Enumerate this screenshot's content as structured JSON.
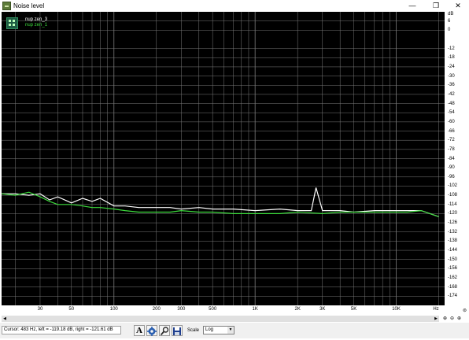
{
  "window": {
    "title": "Noise level",
    "minimize_glyph": "—",
    "maximize_glyph": "❒",
    "close_glyph": "✕"
  },
  "legend": {
    "items": [
      {
        "label": "nup zen_3",
        "color": "#ffffff"
      },
      {
        "label": "nup zen_1",
        "color": "#3ddc3d"
      }
    ]
  },
  "yaxis": {
    "unit": "dB",
    "ticks": [
      "6",
      "0",
      "-12",
      "-18",
      "-24",
      "-30",
      "-36",
      "-42",
      "-48",
      "-54",
      "-60",
      "-66",
      "-72",
      "-78",
      "-84",
      "-90",
      "-96",
      "-102",
      "-108",
      "-114",
      "-120",
      "-126",
      "-132",
      "-138",
      "-144",
      "-150",
      "-156",
      "-162",
      "-168",
      "-174"
    ],
    "tick_values": [
      6,
      0,
      -12,
      -18,
      -24,
      -30,
      -36,
      -42,
      -48,
      -54,
      -60,
      -66,
      -72,
      -78,
      -84,
      -90,
      -96,
      -102,
      -108,
      -114,
      -120,
      -126,
      -132,
      -138,
      -144,
      -150,
      -156,
      -162,
      -168,
      -174
    ]
  },
  "xaxis": {
    "unit": "Hz",
    "ticks": [
      {
        "label": "30",
        "value": 30
      },
      {
        "label": "50",
        "value": 50
      },
      {
        "label": "100",
        "value": 100
      },
      {
        "label": "200",
        "value": 200
      },
      {
        "label": "300",
        "value": 300
      },
      {
        "label": "500",
        "value": 500
      },
      {
        "label": "1K",
        "value": 1000
      },
      {
        "label": "2K",
        "value": 2000
      },
      {
        "label": "3K",
        "value": 3000
      },
      {
        "label": "5K",
        "value": 5000
      },
      {
        "label": "10K",
        "value": 10000
      }
    ]
  },
  "chart_data": {
    "type": "line",
    "title": "",
    "xlabel": "Hz",
    "ylabel": "dB",
    "x_scale": "log",
    "xlim": [
      16,
      22000
    ],
    "ylim": [
      -180,
      12
    ],
    "grid": true,
    "legend_placement": "top-left",
    "background": "#000000",
    "grid_color": "#7a7a7a",
    "series": [
      {
        "name": "nup zen_3",
        "color": "#ffffff",
        "x": [
          16,
          20,
          25,
          30,
          35,
          40,
          50,
          60,
          70,
          80,
          100,
          120,
          150,
          200,
          250,
          300,
          400,
          500,
          700,
          1000,
          1500,
          2000,
          2500,
          2700,
          3000,
          4000,
          5000,
          7000,
          10000,
          15000,
          20000
        ],
        "y": [
          -107,
          -107,
          -108,
          -107,
          -111,
          -109,
          -113,
          -110,
          -112,
          -110,
          -115,
          -115,
          -116,
          -116,
          -116,
          -117,
          -116,
          -117,
          -117,
          -118,
          -117,
          -118,
          -118,
          -103,
          -118,
          -118,
          -119,
          -118,
          -118,
          -118,
          -122
        ]
      },
      {
        "name": "nup zen_1",
        "color": "#3ddc3d",
        "x": [
          16,
          20,
          25,
          30,
          35,
          40,
          50,
          60,
          70,
          80,
          100,
          120,
          150,
          200,
          250,
          300,
          400,
          500,
          700,
          1000,
          1500,
          2000,
          3000,
          4000,
          5000,
          7000,
          8000,
          10000,
          12000,
          15000,
          20000
        ],
        "y": [
          -107,
          -108,
          -106,
          -109,
          -112,
          -114,
          -114,
          -115,
          -116,
          -116,
          -117,
          -118,
          -119,
          -119,
          -119,
          -118,
          -119,
          -119,
          -120,
          -120,
          -120,
          -119,
          -120,
          -119,
          -119,
          -119,
          -119,
          -119,
          -119,
          -118,
          -122
        ]
      }
    ]
  },
  "scrollbar": {
    "left_glyph": "◀",
    "right_glyph": "▶"
  },
  "zoom": {
    "zoom_in_glyph": "⊕",
    "zoom_out_glyph": "⊖",
    "zoom_fit_glyph": "⊜"
  },
  "status": {
    "cursor_text": "Cursor: 483 Hz, left = -119.18 dB, right = -121.61 dB",
    "font_button_label": "A",
    "scale_label": "Scale",
    "scale_value": "Log",
    "scale_arrow": "▼"
  }
}
